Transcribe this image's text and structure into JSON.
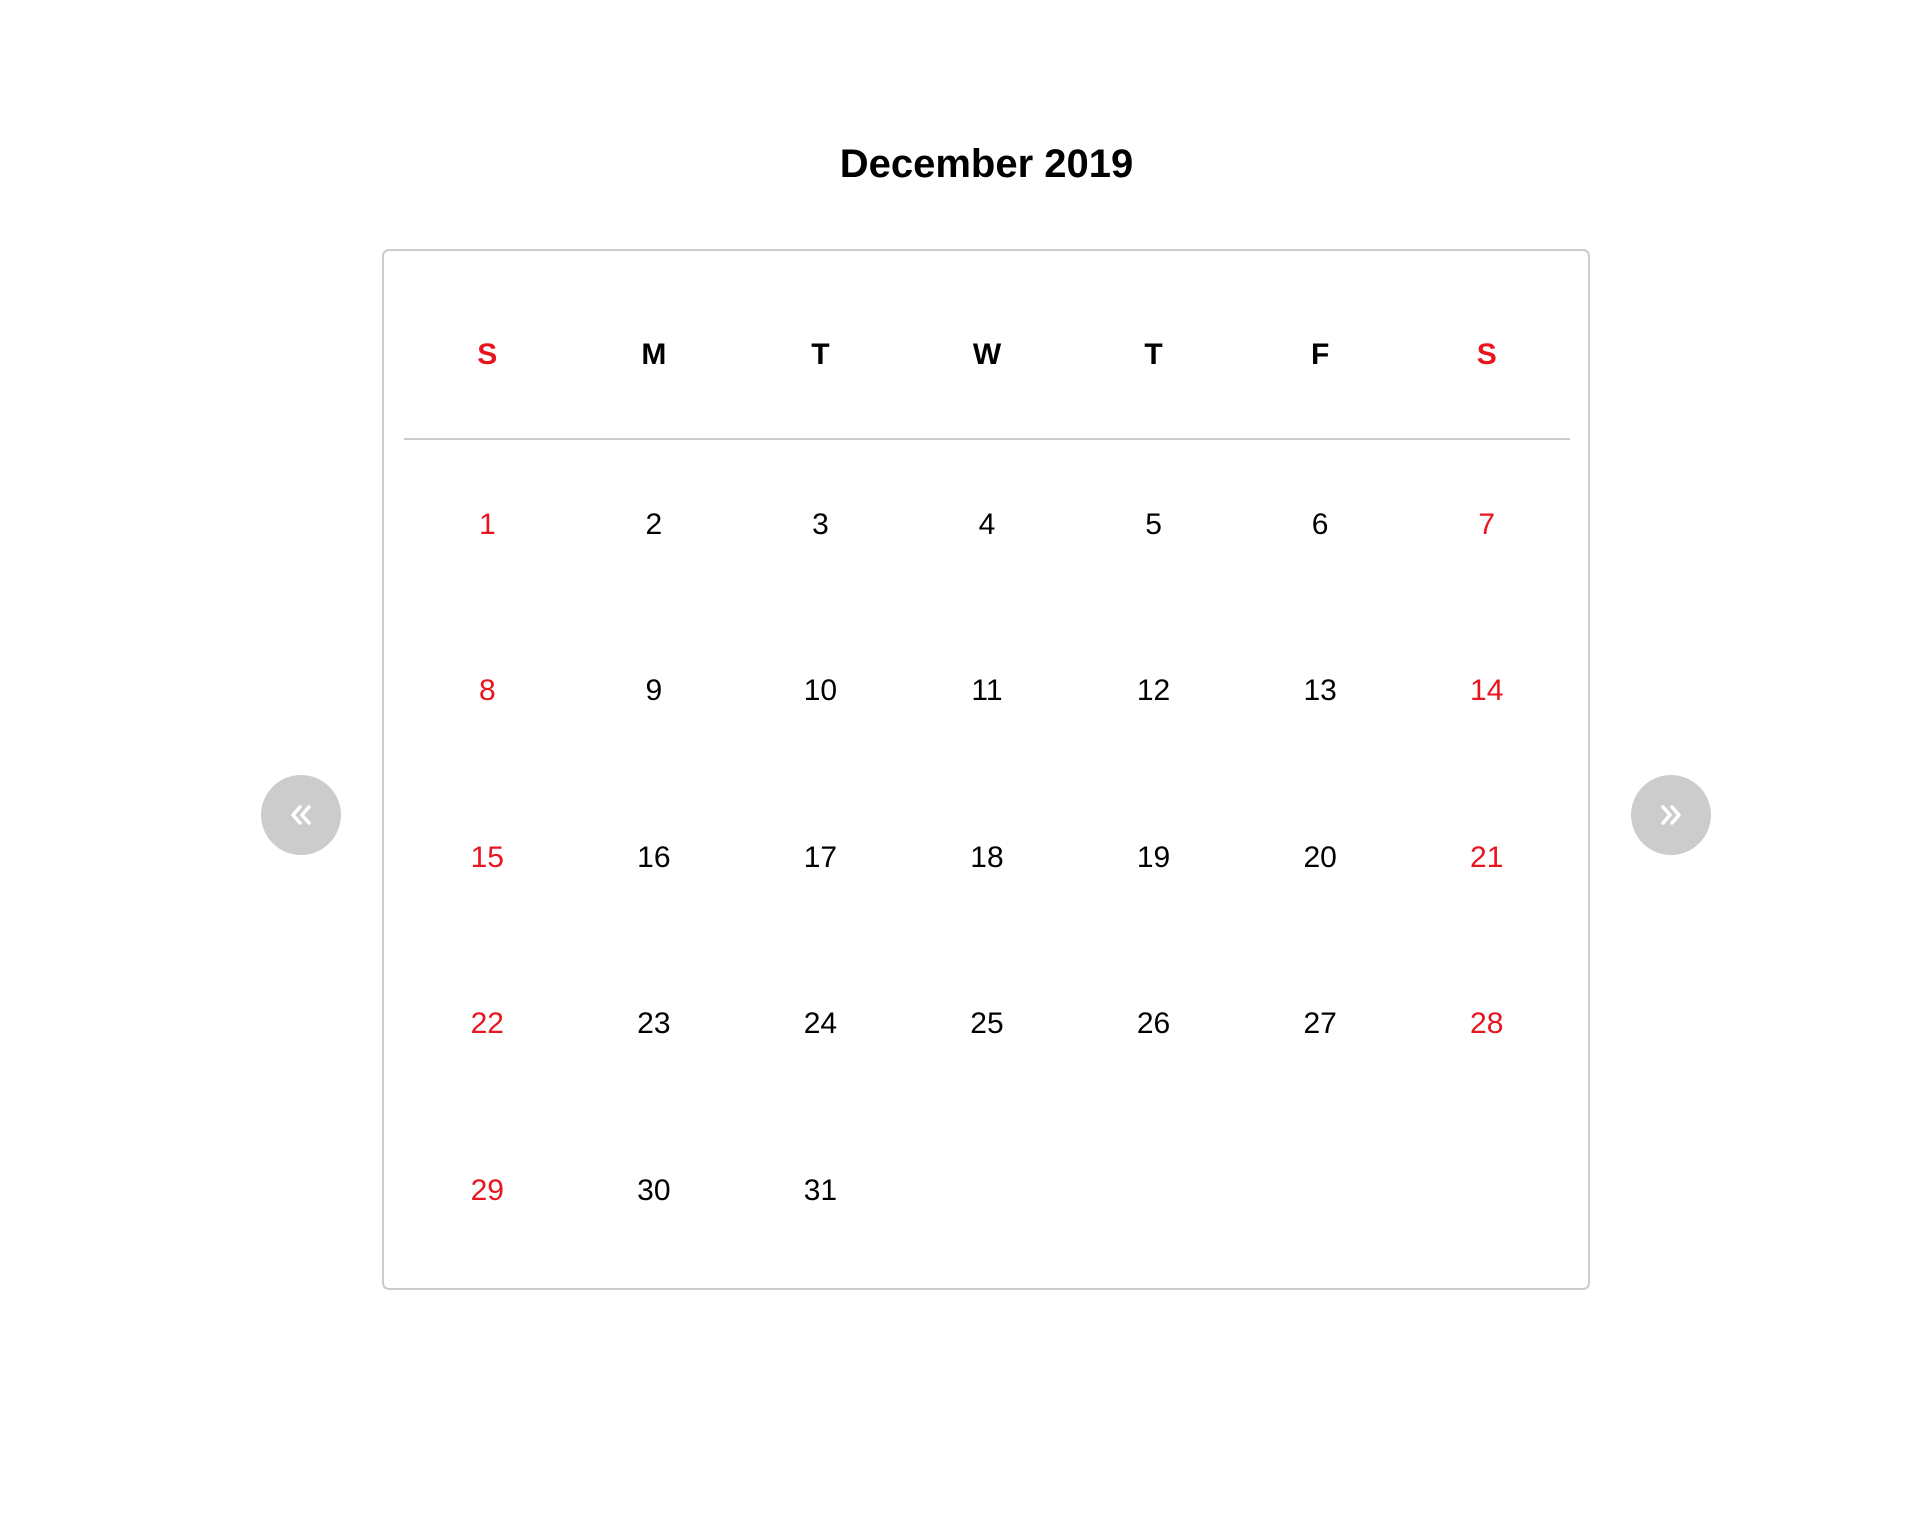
{
  "calendar": {
    "title": "December 2019",
    "weekdays": [
      {
        "label": "S",
        "weekend": true
      },
      {
        "label": "M",
        "weekend": false
      },
      {
        "label": "T",
        "weekend": false
      },
      {
        "label": "W",
        "weekend": false
      },
      {
        "label": "T",
        "weekend": false
      },
      {
        "label": "F",
        "weekend": false
      },
      {
        "label": "S",
        "weekend": true
      }
    ],
    "days": [
      "1",
      "2",
      "3",
      "4",
      "5",
      "6",
      "7",
      "8",
      "9",
      "10",
      "11",
      "12",
      "13",
      "14",
      "15",
      "16",
      "17",
      "18",
      "19",
      "20",
      "21",
      "22",
      "23",
      "24",
      "25",
      "26",
      "27",
      "28",
      "29",
      "30",
      "31"
    ],
    "first_weekday_index": 0
  },
  "navigation": {
    "prev_icon": "double-chevron-left-icon",
    "next_icon": "double-chevron-right-icon"
  },
  "colors": {
    "weekend": "#e8141e",
    "text": "#000000",
    "border": "#cccccc",
    "nav_button": "#cccccc",
    "nav_icon": "#ffffff"
  }
}
